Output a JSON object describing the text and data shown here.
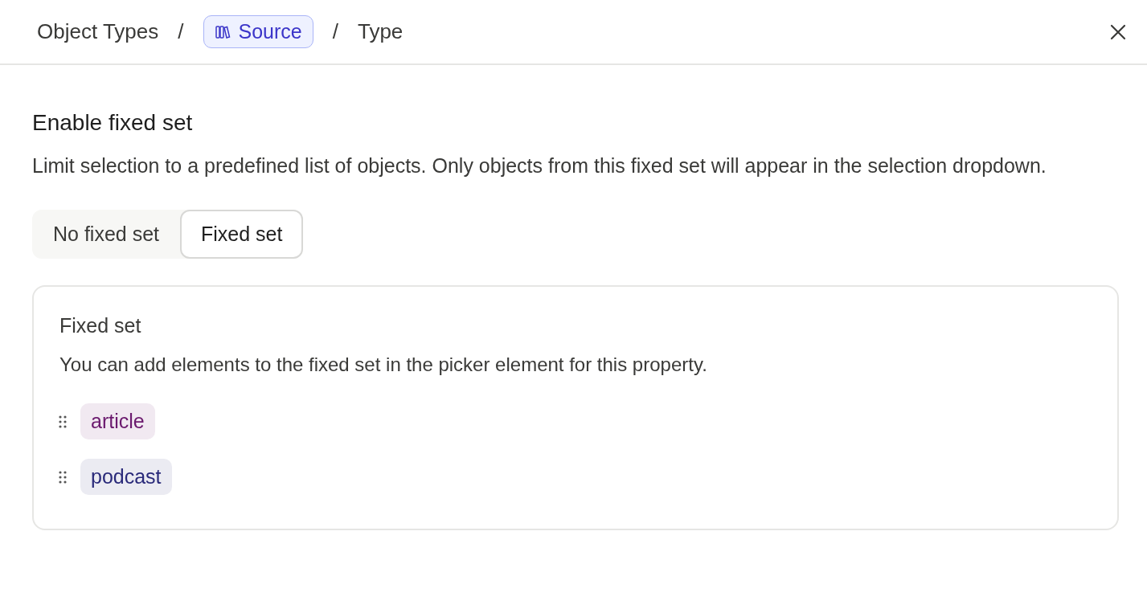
{
  "breadcrumb": [
    {
      "label": "Object Types",
      "kind": "text"
    },
    {
      "label": "/",
      "kind": "separator"
    },
    {
      "label": "Source",
      "kind": "chip"
    },
    {
      "label": "/",
      "kind": "separator"
    },
    {
      "label": "Type",
      "kind": "text"
    }
  ],
  "section": {
    "title": "Enable fixed set",
    "description": "Limit selection to a predefined list of objects. Only objects from this fixed set will appear in the selection dropdown."
  },
  "segments": [
    {
      "label": "No fixed set",
      "selected": false
    },
    {
      "label": "Fixed set",
      "selected": true
    }
  ],
  "card": {
    "title": "Fixed set",
    "description": "You can add elements to the fixed set in the picker element for this property.",
    "items": [
      {
        "label": "article",
        "color": "#6b1a6e"
      },
      {
        "label": "podcast",
        "color": "#2a2a7a"
      }
    ]
  }
}
